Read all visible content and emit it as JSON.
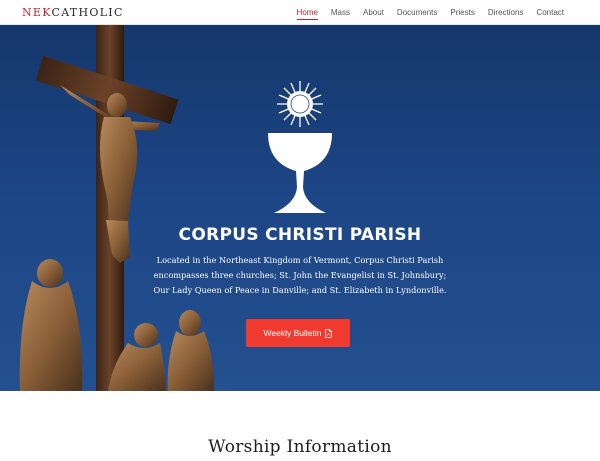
{
  "brand": {
    "accent": "NEK",
    "rest": "CATHOLIC"
  },
  "nav": {
    "items": [
      {
        "label": "Home",
        "active": true
      },
      {
        "label": "Mass"
      },
      {
        "label": "About"
      },
      {
        "label": "Documents"
      },
      {
        "label": "Priests"
      },
      {
        "label": "Directions"
      },
      {
        "label": "Contact"
      }
    ]
  },
  "hero": {
    "title": "CORPUS CHRISTI PARISH",
    "description": "Located in the Northeast Kingdom of Vermont, Corpus Christi Parish encompasses three churches; St. John the Evangelist in St. Johnsbury; Our Lady Queen of Peace in Danville; and St. Elizabeth in Lyndonville.",
    "button_label": "Weekly Bulletin",
    "button_icon": "pdf-file-icon",
    "emblem_icon": "chalice-host-icon"
  },
  "section": {
    "title": "Worship Information"
  },
  "colors": {
    "accent": "#c8222a",
    "button": "#f03a2f",
    "hero_bg": "#1c4585"
  }
}
